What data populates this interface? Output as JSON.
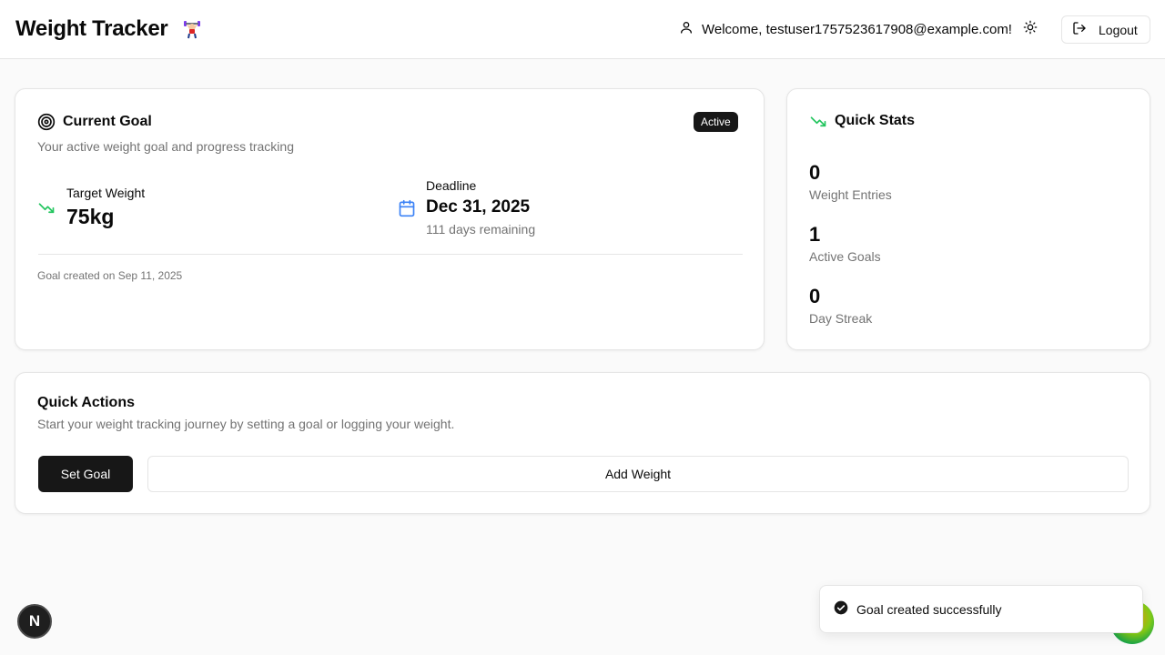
{
  "header": {
    "title": "Weight Tracker",
    "welcome": "Welcome, testuser1757523617908@example.com!",
    "logout_label": "Logout"
  },
  "goal_card": {
    "title": "Current Goal",
    "subtitle": "Your active weight goal and progress tracking",
    "badge": "Active",
    "target_label": "Target Weight",
    "target_value": "75kg",
    "deadline_label": "Deadline",
    "deadline_value": "Dec 31, 2025",
    "remaining": "111 days remaining",
    "created": "Goal created on Sep 11, 2025"
  },
  "stats_card": {
    "title": "Quick Stats",
    "stats": [
      {
        "value": "0",
        "label": "Weight Entries"
      },
      {
        "value": "1",
        "label": "Active Goals"
      },
      {
        "value": "0",
        "label": "Day Streak"
      }
    ]
  },
  "actions_card": {
    "title": "Quick Actions",
    "subtitle": "Start your weight tracking journey by setting a goal or logging your weight.",
    "set_goal_label": "Set Goal",
    "add_weight_label": "Add Weight"
  },
  "toast": {
    "message": "Goal created successfully"
  },
  "dev_badge": {
    "letter": "N"
  },
  "colors": {
    "accent_green": "#22c55e",
    "calendar_blue": "#3b82f6",
    "dark": "#171717"
  },
  "icons": {
    "header_emoji": "weightlifter-icon",
    "user": "user-icon",
    "theme": "sun-icon",
    "logout": "logout-icon",
    "goal": "target-icon",
    "trend": "trending-down-icon",
    "deadline": "calendar-icon",
    "toast": "check-circle-icon"
  }
}
